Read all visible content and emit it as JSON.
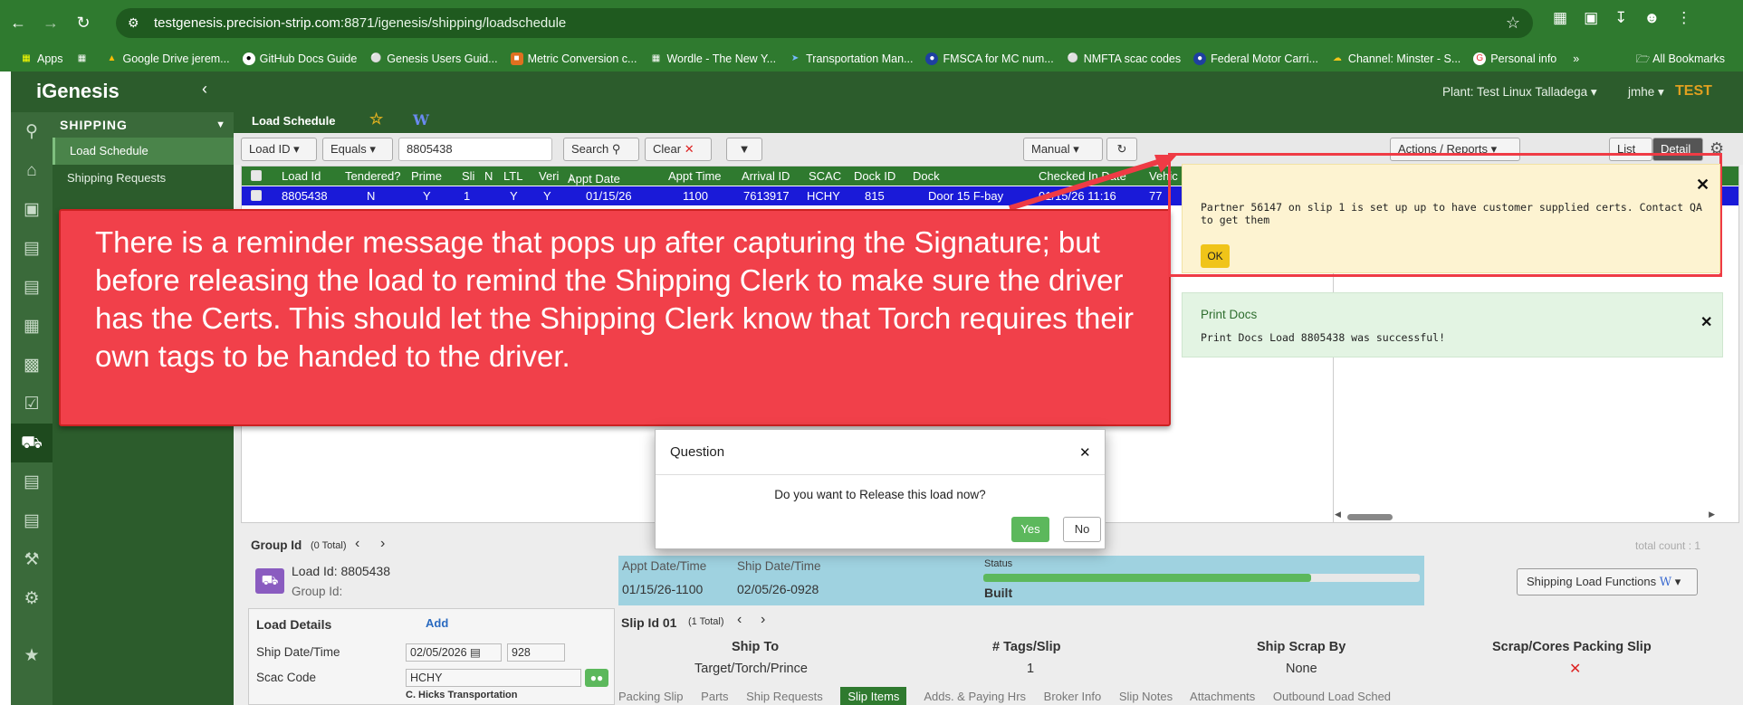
{
  "browser": {
    "url_host": "testgenesis.precision-strip.com",
    "url_rest": ":8871/igenesis/shipping/loadschedule",
    "bookmarks": [
      "Apps",
      "Google Drive jerem...",
      "GitHub Docs Guide",
      "Genesis Users Guid...",
      "Metric Conversion c...",
      "Wordle - The New Y...",
      "Transportation Man...",
      "FMSCA for MC num...",
      "NMFTA scac codes",
      "Federal Motor Carri...",
      "Channel: Minster - S...",
      "Personal info"
    ],
    "all_bookmarks": "All Bookmarks"
  },
  "app": {
    "brand": "iGenesis",
    "plant": "Plant: Test Linux Talladega",
    "user": "jmhe",
    "env": "TEST"
  },
  "nav": {
    "section": "SHIPPING",
    "items": [
      "Load Schedule",
      "Shipping Requests"
    ]
  },
  "page": {
    "title": "Load Schedule"
  },
  "toolbar": {
    "field_select": "Load ID",
    "op_select": "Equals",
    "search_value": "8805438",
    "search_label": "Search",
    "clear_label": "Clear",
    "mode_select": "Manual",
    "actions_label": "Actions / Reports",
    "list_label": "List",
    "detail_label": "Detail"
  },
  "grid": {
    "columns": [
      "Load Id",
      "Tendered?",
      "Prime",
      "Sli",
      "N",
      "LTL",
      "Veri",
      "Appt Date",
      "Appt Time",
      "Arrival ID",
      "SCAC",
      "Dock ID",
      "Dock",
      "Checked In Date",
      "Vehic"
    ],
    "row": [
      "8805438",
      "N",
      "Y",
      "1",
      "",
      "Y",
      "Y",
      "01/15/26",
      "1100",
      "7613917",
      "HCHY",
      "815",
      "Door 15 F-bay",
      "01/15/26 11:16",
      "77"
    ]
  },
  "annotation": {
    "text": "There is a reminder message that pops up after capturing the Signature; but before releasing the load to remind the Shipping Clerk to make sure the driver has the Certs. This should let the Shipping Clerk know that Torch requires their own tags to be handed to the driver.",
    "color": "#f1404a"
  },
  "warning_toast": {
    "message": "Partner 56147 on slip 1 is set up up to have customer supplied certs.  Contact QA to get them",
    "ok_label": "OK"
  },
  "success_toast": {
    "title": "Print Docs",
    "message": "Print Docs Load 8805438 was successful!"
  },
  "dialog": {
    "title": "Question",
    "question": "Do you want to Release this load now?",
    "yes_label": "Yes",
    "no_label": "No"
  },
  "details": {
    "group_id_label": "Group Id",
    "group_total": "(0 Total)",
    "load_id_label": "Load Id:",
    "load_id": "8805438",
    "group_id2_label": "Group Id:",
    "load_details_label": "Load Details",
    "add_label": "Add",
    "ship_date_label": "Ship Date/Time",
    "ship_date_value": "02/05/2026",
    "ship_time_value": "928",
    "scac_label": "Scac Code",
    "scac_value": "HCHY",
    "carrier_name": "C. Hicks Transportation",
    "appt_header": "Appt Date/Time",
    "ship_header": "Ship Date/Time",
    "appt_value": "01/15/26-1100",
    "ship_value": "02/05/26-0928",
    "status_label": "Status",
    "status_value": "Built",
    "status_progress": 0.75,
    "total_count": "total count : 1",
    "shipping_functions": "Shipping Load Functions",
    "slip_id_label": "Slip Id 01",
    "slip_total": "(1 Total)",
    "ship_to_label": "Ship To",
    "ship_to_value": "Target/Torch/Prince",
    "tags_label": "# Tags/Slip",
    "tags_value": "1",
    "scrap_label": "Ship Scrap By",
    "scrap_value": "None",
    "cores_label": "Scrap/Cores Packing Slip",
    "tabs": [
      "Packing Slip",
      "Parts",
      "Ship Requests",
      "Slip Items",
      "Adds. & Paying Hrs",
      "Broker Info",
      "Slip Notes",
      "Attachments",
      "Outbound Load Sched"
    ]
  }
}
